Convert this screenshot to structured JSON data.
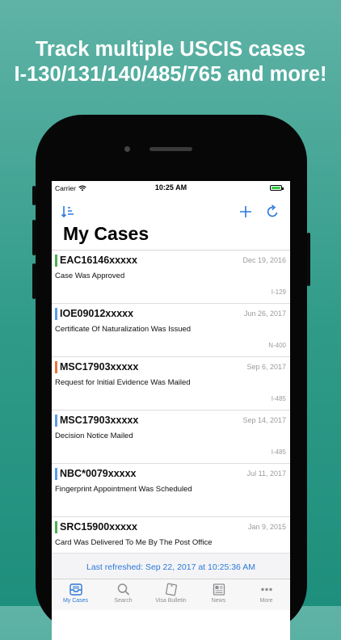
{
  "banner": {
    "line1": "Track multiple USCIS cases",
    "line2": "I-130/131/140/485/765 and more!"
  },
  "status_bar": {
    "carrier": "Carrier",
    "time": "10:25 AM"
  },
  "nav": {
    "title": "My Cases",
    "sort_icon": "sort-icon",
    "add_icon": "plus-icon",
    "refresh_icon": "refresh-icon"
  },
  "colors": {
    "accent": "#2c79d8",
    "approved": "#4caf50",
    "pending": "#5a9de8",
    "evidence": "#e8743b"
  },
  "cases": [
    {
      "number": "EAC16146xxxxx",
      "date": "Dec 19, 2016",
      "status": "Case Was Approved",
      "form": "I-129",
      "color": "#4caf50"
    },
    {
      "number": "IOE09012xxxxx",
      "date": "Jun 26, 2017",
      "status": "Certificate Of Naturalization Was Issued",
      "form": "N-400",
      "color": "#5a9de8"
    },
    {
      "number": "MSC17903xxxxx",
      "date": "Sep 6, 2017",
      "status": "Request for Initial Evidence Was Mailed",
      "form": "I-485",
      "color": "#e8743b"
    },
    {
      "number": "MSC17903xxxxx",
      "date": "Sep 14, 2017",
      "status": "Decision Notice Mailed",
      "form": "I-485",
      "color": "#5a9de8"
    },
    {
      "number": "NBC*0079xxxxx",
      "date": "Jul 11, 2017",
      "status": "Fingerprint Appointment Was Scheduled",
      "form": "",
      "color": "#5a9de8"
    },
    {
      "number": "SRC15900xxxxx",
      "date": "Jan 9, 2015",
      "status": "Card Was Delivered To Me By The Post Office",
      "form": "",
      "color": "#4caf50"
    }
  ],
  "footer": {
    "last_refreshed": "Last refreshed: Sep 22, 2017 at 10:25:36 AM"
  },
  "tabs": [
    {
      "label": "My Cases",
      "icon": "inbox-icon",
      "active": true
    },
    {
      "label": "Search",
      "icon": "search-icon",
      "active": false
    },
    {
      "label": "Visa Bulletin",
      "icon": "bulletin-icon",
      "active": false
    },
    {
      "label": "News",
      "icon": "news-icon",
      "active": false
    },
    {
      "label": "More",
      "icon": "more-icon",
      "active": false
    }
  ]
}
